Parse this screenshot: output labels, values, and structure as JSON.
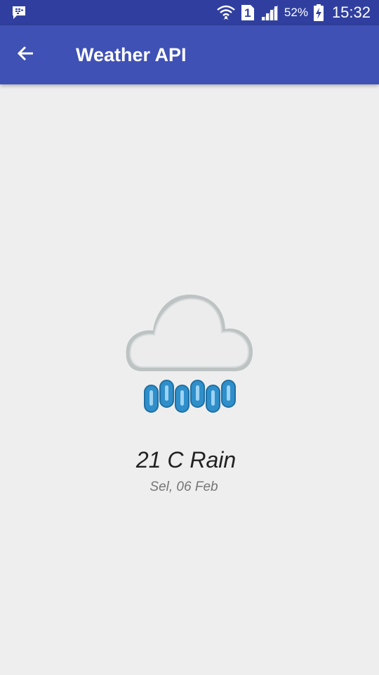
{
  "status_bar": {
    "left_icon": "bbm-notification-icon",
    "icons": [
      "wifi-icon",
      "sim-1-icon",
      "signal-icon",
      "battery-charging-icon"
    ],
    "sim_label": "1",
    "battery_percent": "52%",
    "time": "15:32"
  },
  "app_bar": {
    "back_icon": "arrow-back-icon",
    "title": "Weather API"
  },
  "weather": {
    "icon": "cloud-rain-icon",
    "summary": "21 C Rain",
    "date": "Sel, 06 Feb"
  },
  "colors": {
    "status_bar": "#303f9f",
    "app_bar": "#3f51b5",
    "background": "#eeeeee",
    "rain": "#2f8fcb"
  }
}
